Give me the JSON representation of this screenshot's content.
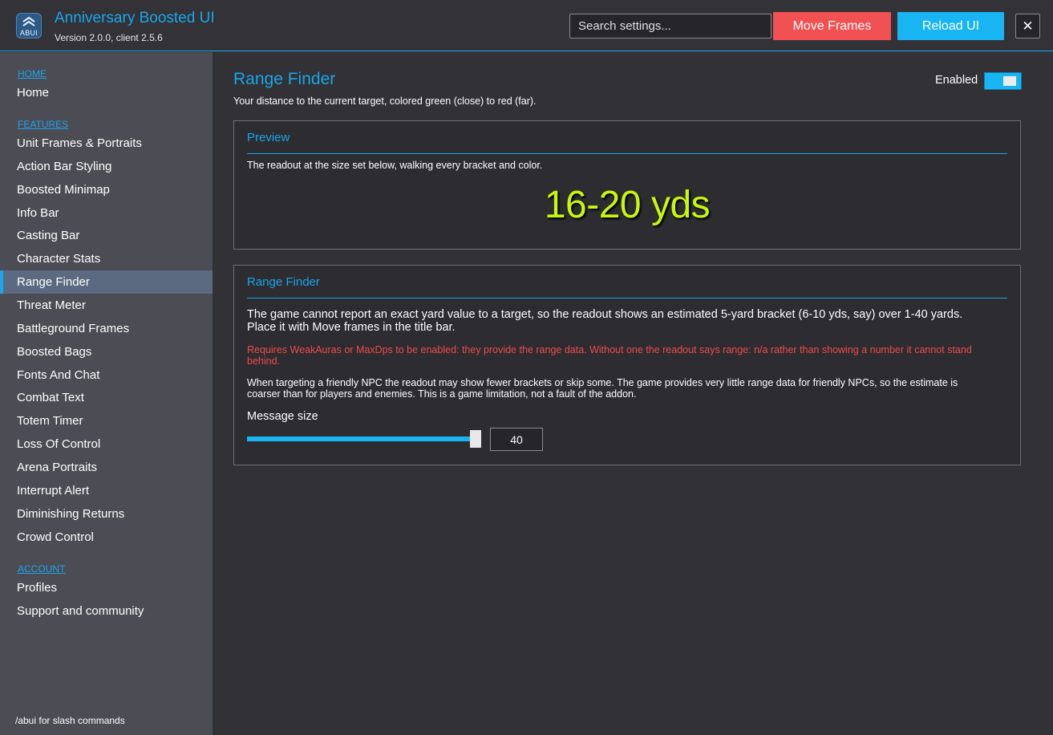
{
  "app": {
    "logo_text": "ABUI",
    "title": "Anniversary Boosted UI",
    "version": "Version 2.0.0, client 2.5.6"
  },
  "toolbar": {
    "search_placeholder": "Search settings...",
    "move_frames_label": "Move Frames",
    "reload_label": "Reload UI",
    "close_label": "✕"
  },
  "colors": {
    "accent": "#1aa6e8",
    "move_button": "#f15152",
    "reload_button": "#19b5f3",
    "warning_text": "#f04b4b",
    "readout": "#c9f70b"
  },
  "sidebar": {
    "sections": {
      "home": "HOME",
      "features": "FEATURES",
      "account": "ACCOUNT"
    },
    "home_items": [
      "Home"
    ],
    "feature_items": [
      "Unit Frames & Portraits",
      "Action Bar Styling",
      "Boosted Minimap",
      "Info Bar",
      "Casting Bar",
      "Character Stats",
      "Range Finder",
      "Threat Meter",
      "Battleground Frames",
      "Boosted Bags",
      "Fonts And Chat",
      "Combat Text",
      "Totem Timer",
      "Loss Of Control",
      "Arena Portraits",
      "Interrupt Alert",
      "Diminishing Returns",
      "Crowd Control"
    ],
    "account_items": [
      "Profiles",
      "Support and community"
    ],
    "active_item": "Range Finder",
    "footer": "/abui for slash commands"
  },
  "page": {
    "title": "Range Finder",
    "description": "Your distance to the current target, colored green (close) to red (far).",
    "enabled_label": "Enabled",
    "enabled": true
  },
  "preview_panel": {
    "header": "Preview",
    "text": "The readout at the size set below, walking every bracket and color.",
    "readout": "16-20 yds"
  },
  "settings_panel": {
    "header": "Range Finder",
    "intro": "The game cannot report an exact yard value to a target, so the readout shows an estimated 5-yard bracket (6-10 yds, say) over 1-40 yards.  Place it with Move frames in the title bar.",
    "warning": "Requires WeakAuras or MaxDps to be enabled: they provide the range data.  Without one the readout says range: n/a rather than showing a number it cannot stand behind.",
    "note": "When targeting a friendly NPC the readout may show fewer brackets or skip some.  The game provides very little range data for friendly NPCs, so the estimate is coarser than for players and enemies.  This is a game limitation, not a fault of the addon.",
    "slider_label": "Message size",
    "slider_value": "40",
    "slider_fraction": 1.0
  }
}
